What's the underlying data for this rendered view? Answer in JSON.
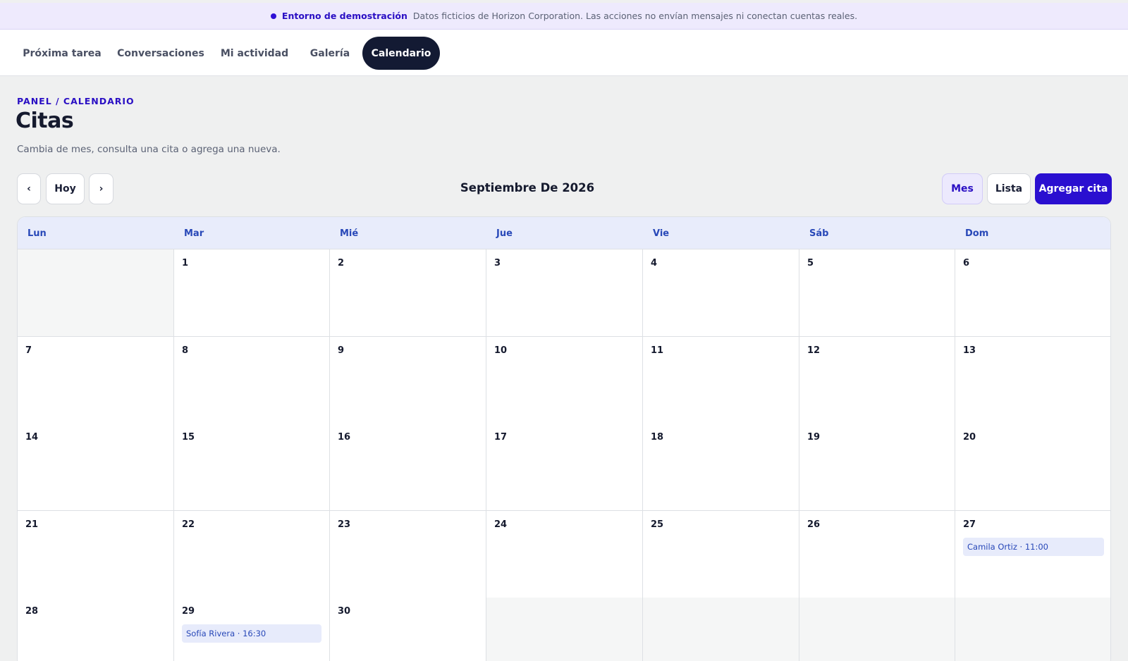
{
  "banner": {
    "title": "Entorno de demostración",
    "desc": "Datos ficticios de Horizon Corporation. Las acciones no envían mensajes ni conectan cuentas reales."
  },
  "nav": {
    "tabs": [
      {
        "label": "Próxima tarea"
      },
      {
        "label": "Conversaciones"
      },
      {
        "label": "Mi actividad"
      },
      {
        "label": "Galería"
      },
      {
        "label": "Calendario",
        "active": true
      }
    ]
  },
  "header": {
    "breadcrumb": "PANEL / CALENDARIO",
    "title": "Citas",
    "subtitle": "Cambia de mes, consulta una cita o agrega una nueva."
  },
  "toolbar": {
    "prev": "‹",
    "today": "Hoy",
    "next": "›",
    "month": "Septiembre De 2026",
    "view_month": "Mes",
    "view_list": "Lista",
    "add": "Agregar cita"
  },
  "calendar": {
    "weekdays": [
      "Lun",
      "Mar",
      "Mié",
      "Jue",
      "Vie",
      "Sáb",
      "Dom"
    ],
    "weeks": [
      [
        null,
        1,
        2,
        3,
        4,
        5,
        6
      ],
      [
        7,
        8,
        9,
        10,
        11,
        12,
        13
      ],
      [
        14,
        15,
        16,
        17,
        18,
        19,
        20
      ],
      [
        21,
        22,
        23,
        24,
        25,
        26,
        27
      ],
      [
        28,
        29,
        30,
        null,
        null,
        null,
        null
      ]
    ],
    "events": [
      {
        "day": 27,
        "label": "Camila Ortiz · 11:00"
      },
      {
        "day": 29,
        "label": "Sofía Rivera · 16:30"
      }
    ]
  },
  "colors": {
    "accent": "#2a0fd0",
    "nav_active": "#131a33",
    "weekday_text": "#2848b8",
    "event_bg": "#e7ebfb"
  }
}
